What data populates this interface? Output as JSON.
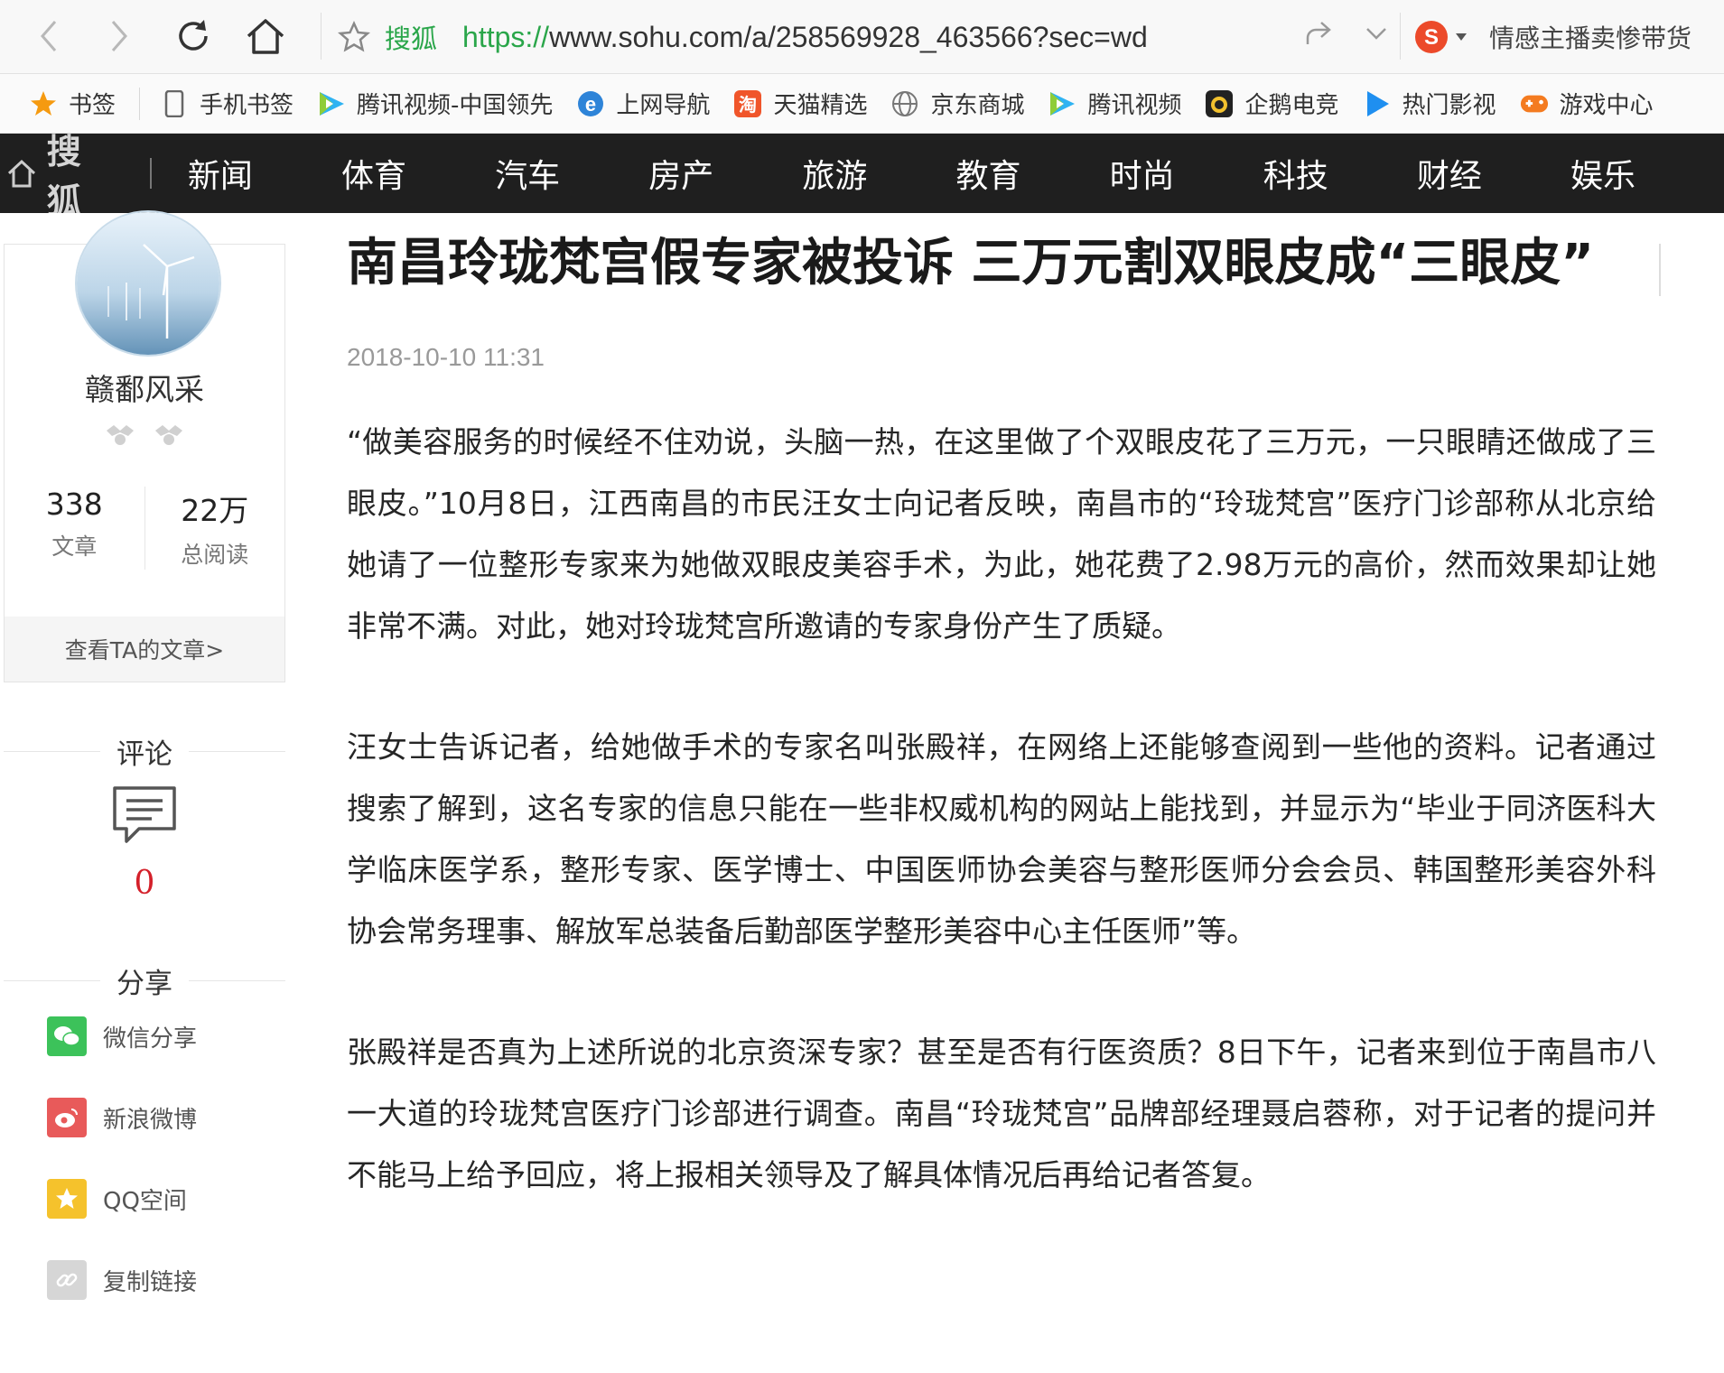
{
  "browser": {
    "site_label": "搜狐",
    "url_proto": "https://",
    "url_rest": "www.sohu.com/a/258569928_463566?sec=wd",
    "search_text": "情感主播卖惨带货"
  },
  "bookmarks": [
    {
      "label": "书签",
      "icon": "star-icon"
    },
    {
      "label": "手机书签",
      "icon": "phone-icon"
    },
    {
      "label": "腾讯视频-中国领先",
      "icon": "tencent-video-icon"
    },
    {
      "label": "上网导航",
      "icon": "ie-icon"
    },
    {
      "label": "天猫精选",
      "icon": "tmall-icon"
    },
    {
      "label": "京东商城",
      "icon": "globe-icon"
    },
    {
      "label": "腾讯视频",
      "icon": "tencent-video-icon"
    },
    {
      "label": "企鹅电竞",
      "icon": "penguin-icon"
    },
    {
      "label": "热门影视",
      "icon": "play-icon"
    },
    {
      "label": "游戏中心",
      "icon": "gamepad-icon"
    }
  ],
  "site_nav": {
    "logo": "搜狐",
    "items": [
      "新闻",
      "体育",
      "汽车",
      "房产",
      "旅游",
      "教育",
      "时尚",
      "科技",
      "财经",
      "娱乐"
    ]
  },
  "author": {
    "name": "赣鄱风采",
    "articles_count": "338",
    "articles_label": "文章",
    "reads_count": "22万",
    "reads_label": "总阅读",
    "view_articles": "查看TA的文章>"
  },
  "comments": {
    "title": "评论",
    "count": "0"
  },
  "share": {
    "title": "分享",
    "items": [
      {
        "label": "微信分享",
        "icon": "wechat-icon",
        "color": "#3cc25a"
      },
      {
        "label": "新浪微博",
        "icon": "weibo-icon",
        "color": "#e85a5a"
      },
      {
        "label": "QQ空间",
        "icon": "qzone-icon",
        "color": "#f5c22c"
      },
      {
        "label": "复制链接",
        "icon": "link-icon",
        "color": "#d6d6d6"
      }
    ]
  },
  "article": {
    "title": "南昌玲珑梵宫假专家被投诉 三万元割双眼皮成“三眼皮”",
    "date": "2018-10-10 11:31",
    "paragraphs": [
      "“做美容服务的时候经不住劝说，头脑一热，在这里做了个双眼皮花了三万元，一只眼睛还做成了三眼皮。”10月8日，江西南昌的市民汪女士向记者反映，南昌市的“玲珑梵宫”医疗门诊部称从北京给她请了一位整形专家来为她做双眼皮美容手术，为此，她花费了2.98万元的高价，然而效果却让她非常不满。对此，她对玲珑梵宫所邀请的专家身份产生了质疑。",
      "汪女士告诉记者，给她做手术的专家名叫张殿祥，在网络上还能够查阅到一些他的资料。记者通过搜索了解到，这名专家的信息只能在一些非权威机构的网站上能找到，并显示为“毕业于同济医科大学临床医学系，整形专家、医学博士、中国医师协会美容与整形医师分会会员、韩国整形美容外科协会常务理事、解放军总装备后勤部医学整形美容中心主任医师”等。",
      "张殿祥是否真为上述所说的北京资深专家？甚至是否有行医资质？8日下午，记者来到位于南昌市八一大道的玲珑梵宫医疗门诊部进行调查。南昌“玲珑梵宫”品牌部经理聂启蓉称，对于记者的提问并不能马上给予回应，将上报相关领导及了解具体情况后再给记者答复。"
    ]
  }
}
